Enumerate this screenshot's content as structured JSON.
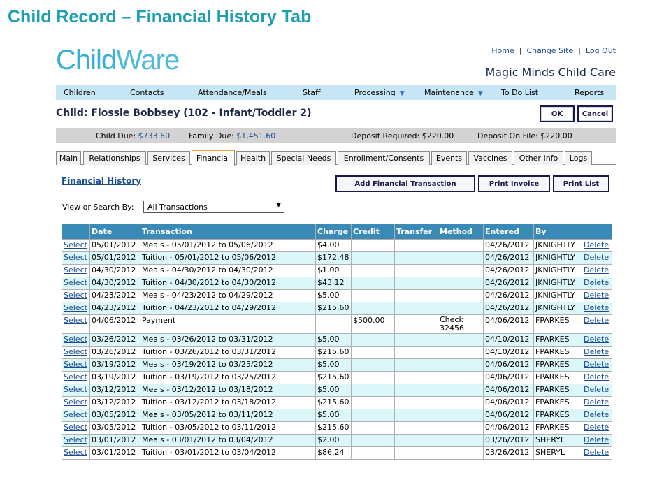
{
  "slide_title": "Child Record – Financial History Tab",
  "app": {
    "logo_part1": "Child",
    "logo_part2": "Ware",
    "top_links": [
      "Home",
      "Change Site",
      "Log Out"
    ],
    "org_name": "Magic Minds Child Care"
  },
  "nav": {
    "items": [
      "Children",
      "Contacts",
      "Attendance/Meals",
      "Staff",
      "Processing",
      "Maintenance",
      "To Do List",
      "Reports"
    ],
    "caret": "▼"
  },
  "child": {
    "title": "Child: Flossie Bobbsey (102 - Infant/Toddler 2)",
    "ok_label": "OK",
    "cancel_label": "Cancel"
  },
  "due": {
    "child_due_label": "Child Due:",
    "child_due_value": "$733.60",
    "family_due_label": "Family Due:",
    "family_due_value": "$1,451.60",
    "deposit_required_label": "Deposit Required:",
    "deposit_required_value": "$220.00",
    "deposit_on_file_label": "Deposit On File:",
    "deposit_on_file_value": "$220.00"
  },
  "tabs": [
    "Main",
    "Relationships",
    "Services",
    "Financial",
    "Health",
    "Special Needs",
    "Enrollment/Consents",
    "Events",
    "Vaccines",
    "Other Info",
    "Logs"
  ],
  "active_tab": "Financial",
  "financial": {
    "section_title": "Financial History",
    "add_button": "Add Financial Transaction",
    "print_invoice_button": "Print Invoice",
    "print_list_button": "Print List",
    "filter_label": "View or Search By:",
    "filter_value": "All Transactions",
    "dropdown_arrow": "▼"
  },
  "table": {
    "columns": [
      "",
      "Date",
      "Transaction",
      "Charge",
      "Credit",
      "Transfer",
      "Method",
      "Entered",
      "By",
      ""
    ],
    "rows": [
      [
        "Select",
        "05/01/2012",
        "Meals - 05/01/2012 to 05/06/2012",
        "$4.00",
        "",
        "",
        "",
        "04/26/2012",
        "JKNIGHTLY",
        "Delete"
      ],
      [
        "Select",
        "05/01/2012",
        "Tuition - 05/01/2012 to 05/06/2012",
        "$172.48",
        "",
        "",
        "",
        "04/26/2012",
        "JKNIGHTLY",
        "Delete"
      ],
      [
        "Select",
        "04/30/2012",
        "Meals - 04/30/2012 to 04/30/2012",
        "$1.00",
        "",
        "",
        "",
        "04/26/2012",
        "JKNIGHTLY",
        "Delete"
      ],
      [
        "Select",
        "04/30/2012",
        "Tuition - 04/30/2012 to 04/30/2012",
        "$43.12",
        "",
        "",
        "",
        "04/26/2012",
        "JKNIGHTLY",
        "Delete"
      ],
      [
        "Select",
        "04/23/2012",
        "Meals - 04/23/2012 to 04/29/2012",
        "$5.00",
        "",
        "",
        "",
        "04/26/2012",
        "JKNIGHTLY",
        "Delete"
      ],
      [
        "Select",
        "04/23/2012",
        "Tuition - 04/23/2012 to 04/29/2012",
        "$215.60",
        "",
        "",
        "",
        "04/26/2012",
        "JKNIGHTLY",
        "Delete"
      ],
      [
        "Select",
        "04/06/2012",
        "Payment",
        "",
        "$500.00",
        "",
        "Check 32456",
        "04/06/2012",
        "FPARKES",
        "Delete"
      ],
      [
        "Select",
        "03/26/2012",
        "Meals - 03/26/2012 to 03/31/2012",
        "$5.00",
        "",
        "",
        "",
        "04/10/2012",
        "FPARKES",
        "Delete"
      ],
      [
        "Select",
        "03/26/2012",
        "Tuition - 03/26/2012 to 03/31/2012",
        "$215.60",
        "",
        "",
        "",
        "04/10/2012",
        "FPARKES",
        "Delete"
      ],
      [
        "Select",
        "03/19/2012",
        "Meals - 03/19/2012 to 03/25/2012",
        "$5.00",
        "",
        "",
        "",
        "04/06/2012",
        "FPARKES",
        "Delete"
      ],
      [
        "Select",
        "03/19/2012",
        "Tuition - 03/19/2012 to 03/25/2012",
        "$215.60",
        "",
        "",
        "",
        "04/06/2012",
        "FPARKES",
        "Delete"
      ],
      [
        "Select",
        "03/12/2012",
        "Meals - 03/12/2012 to 03/18/2012",
        "$5.00",
        "",
        "",
        "",
        "04/06/2012",
        "FPARKES",
        "Delete"
      ],
      [
        "Select",
        "03/12/2012",
        "Tuition - 03/12/2012 to 03/18/2012",
        "$215.60",
        "",
        "",
        "",
        "04/06/2012",
        "FPARKES",
        "Delete"
      ],
      [
        "Select",
        "03/05/2012",
        "Meals - 03/05/2012 to 03/11/2012",
        "$5.00",
        "",
        "",
        "",
        "04/06/2012",
        "FPARKES",
        "Delete"
      ],
      [
        "Select",
        "03/05/2012",
        "Tuition - 03/05/2012 to 03/11/2012",
        "$215.60",
        "",
        "",
        "",
        "04/06/2012",
        "FPARKES",
        "Delete"
      ],
      [
        "Select",
        "03/01/2012",
        "Meals - 03/01/2012 to 03/04/2012",
        "$2.00",
        "",
        "",
        "",
        "03/26/2012",
        "SHERYL",
        "Delete"
      ],
      [
        "Select",
        "03/01/2012",
        "Tuition - 03/01/2012 to 03/04/2012",
        "$86.24",
        "",
        "",
        "",
        "03/26/2012",
        "SHERYL",
        "Delete"
      ]
    ]
  }
}
